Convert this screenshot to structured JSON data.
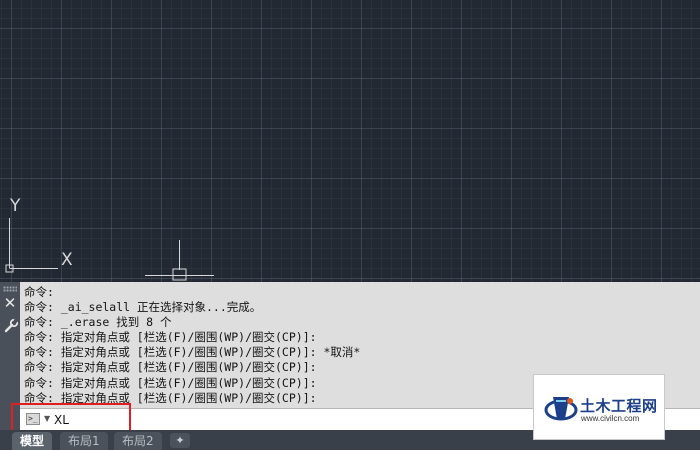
{
  "canvas": {
    "ucs_y_label": "Y",
    "ucs_x_label": "X",
    "colors": {
      "background": "#222933",
      "grid": "#3b4451",
      "axis": "#d8d8d8"
    }
  },
  "command_panel": {
    "history": [
      "命令:",
      "命令: _ai_selall 正在选择对象...完成。",
      "命令: _.erase 找到 8 个",
      "命令: 指定对角点或 [栏选(F)/圈围(WP)/圈交(CP)]:",
      "命令: 指定对角点或 [栏选(F)/圈围(WP)/圈交(CP)]: *取消*",
      "命令: 指定对角点或 [栏选(F)/圈围(WP)/圈交(CP)]:",
      "命令: 指定对角点或 [栏选(F)/圈围(WP)/圈交(CP)]:",
      "命令: 指定对角点或 [栏选(F)/圈围(WP)/圈交(CP)]:"
    ],
    "input_value": "XL",
    "prompt_icon": "command-prompt-icon",
    "close_glyph": "✕",
    "highlight_color": "#e02020"
  },
  "tabs": [
    {
      "label": "模型",
      "active": true
    },
    {
      "label": "布局1",
      "active": false
    },
    {
      "label": "布局2",
      "active": false
    }
  ],
  "tab_add_glyph": "✦",
  "watermark": {
    "text": "土木工程网",
    "url": "www.civilcn.com",
    "brand_color": "#1b3f8a"
  }
}
